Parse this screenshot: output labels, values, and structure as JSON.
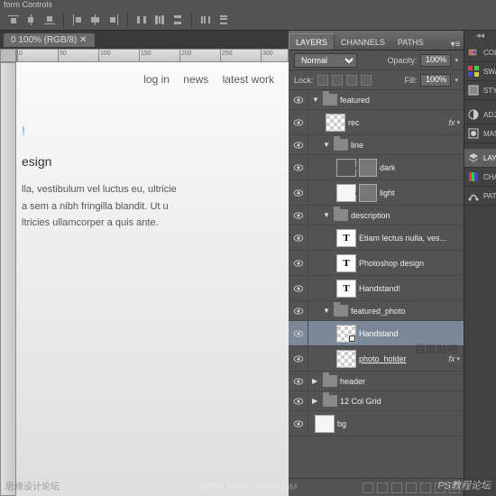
{
  "top_bar": "form Controls",
  "doc": {
    "tab": "0 100% (RGB/8)",
    "ruler_marks": [
      "0",
      "50",
      "100",
      "150",
      "200",
      "250",
      "300"
    ]
  },
  "nav": {
    "login": "log in",
    "news": "news",
    "latest": "latest work"
  },
  "content": {
    "accent": "!",
    "heading": "esign",
    "p1": "lla, vestibulum vel luctus eu, ultricie",
    "p2": "a sem a nibh fringilla blandit. Ut u",
    "p3": "ltricies ullamcorper a quis ante."
  },
  "panel_tabs": {
    "layers": "LAYERS",
    "channels": "CHANNELS",
    "paths": "PATHS"
  },
  "blend_row": {
    "mode": "Normal",
    "opacity_label": "Opacity:",
    "opacity": "100%"
  },
  "lock_row": {
    "label": "Lock:",
    "fill_label": "Fill:",
    "fill": "100%"
  },
  "layers": [
    {
      "type": "group",
      "name": "featured",
      "indent": 0,
      "open": true
    },
    {
      "type": "layer",
      "name": "rec",
      "indent": 1,
      "thumb": "checker",
      "fx": true
    },
    {
      "type": "group",
      "name": "line",
      "indent": 1,
      "open": true
    },
    {
      "type": "layer",
      "name": "dark",
      "indent": 2,
      "thumb": "dark",
      "mask": true
    },
    {
      "type": "layer",
      "name": "light",
      "indent": 2,
      "thumb": "light",
      "mask": true
    },
    {
      "type": "group",
      "name": "description",
      "indent": 1,
      "open": true
    },
    {
      "type": "text",
      "name": "Etiam lectus nulla, ves...",
      "indent": 2
    },
    {
      "type": "text",
      "name": "Photoshop design",
      "indent": 2
    },
    {
      "type": "text",
      "name": "Handstand!",
      "indent": 2
    },
    {
      "type": "group",
      "name": "featured_photo",
      "indent": 1,
      "open": true
    },
    {
      "type": "smart",
      "name": "Handstand",
      "indent": 2,
      "thumb": "checker",
      "selected": true
    },
    {
      "type": "layer",
      "name": "photo_holder",
      "indent": 2,
      "thumb": "checker",
      "fx": true,
      "underline": true
    },
    {
      "type": "group",
      "name": "header",
      "indent": 0,
      "open": false
    },
    {
      "type": "group",
      "name": "12 Col Grid",
      "indent": 0,
      "open": false
    },
    {
      "type": "layer",
      "name": "bg",
      "indent": 0,
      "thumb": "light"
    }
  ],
  "dock": [
    {
      "label": "COLOR",
      "icon": "color"
    },
    {
      "label": "SWATCH",
      "icon": "swatch"
    },
    {
      "label": "STYLES",
      "icon": "styles"
    },
    {
      "label": "ADJUST",
      "icon": "adjust"
    },
    {
      "label": "MASKS",
      "icon": "masks"
    },
    {
      "label": "LAYERS",
      "icon": "layers",
      "active": true
    },
    {
      "label": "CHANN",
      "icon": "channels"
    },
    {
      "label": "PATHS",
      "icon": "paths"
    }
  ],
  "watermarks": {
    "left": "思缘设计论坛",
    "center": "WWW.MISSYUAN.COM",
    "right": "PS教程论坛",
    "overlay": "百度贴吧"
  },
  "fx_label": "fx",
  "arrows": {
    "open": "▼",
    "closed": "▶"
  }
}
